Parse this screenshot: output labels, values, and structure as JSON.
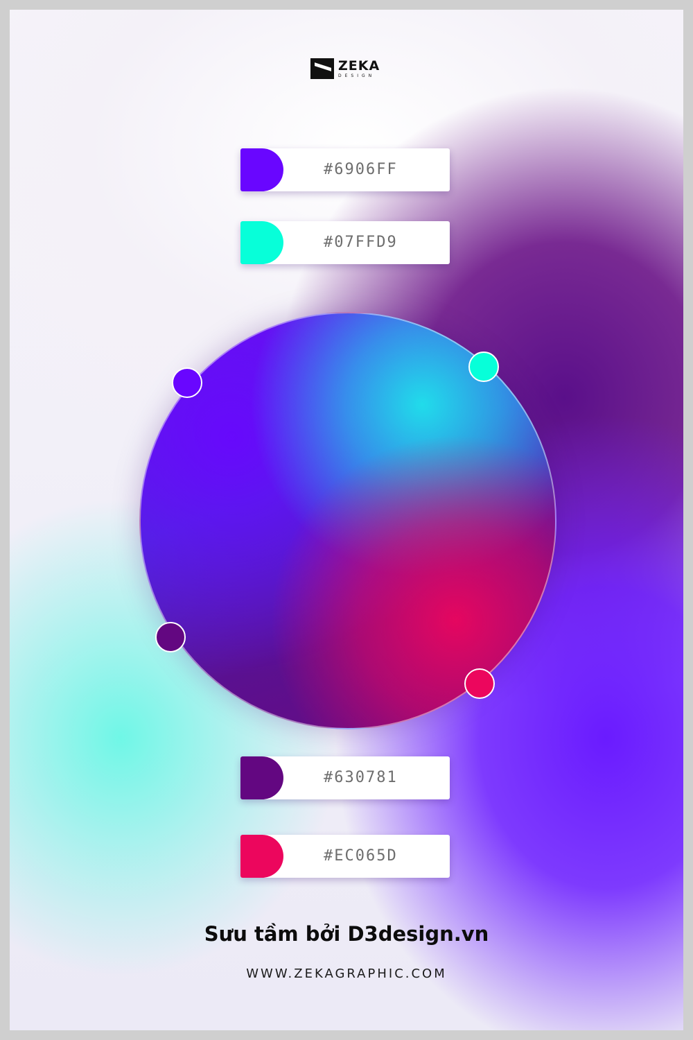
{
  "logo": {
    "name": "ZEKA",
    "sub": "DESIGN"
  },
  "swatches": [
    {
      "hex": "#6906FF",
      "color": "#6906FF"
    },
    {
      "hex": "#07FFD9",
      "color": "#07FFD9"
    },
    {
      "hex": "#630781",
      "color": "#630781"
    },
    {
      "hex": "#EC065D",
      "color": "#EC065D"
    }
  ],
  "credit": "Sưu tầm bởi D3design.vn",
  "website": "WWW.ZEKAGRAPHIC.COM"
}
